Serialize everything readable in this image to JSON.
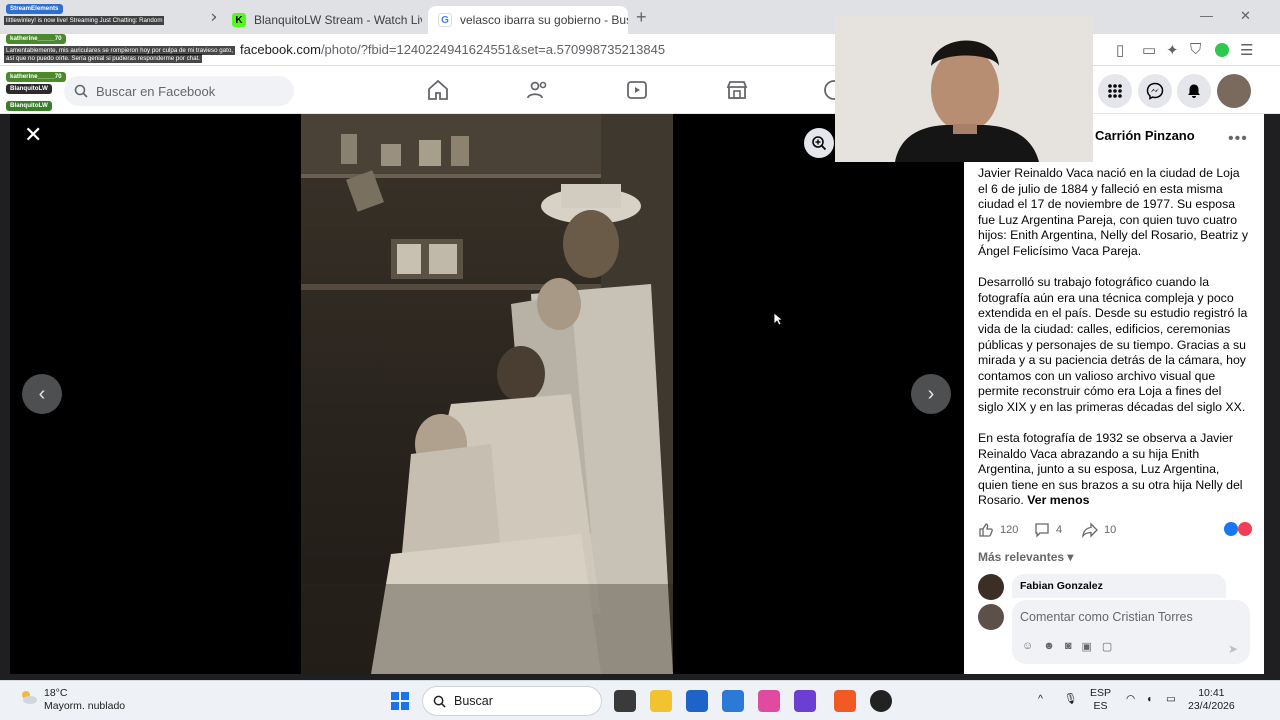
{
  "browser": {
    "tabs": [
      {
        "label": "littlewinley! is now live! Streaming Just Chatting: Random",
        "icon": "stream-icon"
      },
      {
        "label": "BlanquitoLW Stream - Watch Live on",
        "icon": "kick-icon"
      },
      {
        "label": "velasco ibarra su gobierno - Buscar c",
        "icon": "google-icon"
      }
    ],
    "new_tab": "+",
    "url_domain": "facebook.com",
    "url_rest": "/photo/?fbid=1240224941624551&set=a.570998735213845"
  },
  "facebook": {
    "search_placeholder": "Buscar en Facebook",
    "nav_icons": [
      "home-icon",
      "friends-icon",
      "video-icon",
      "marketplace-icon",
      "groups-icon"
    ],
    "header_buttons": [
      "menu-grid-icon",
      "messenger-icon",
      "notifications-icon"
    ]
  },
  "post": {
    "author": "Carrión Pinzano",
    "more": "•••",
    "caption": [
      "Javier Reinaldo Vaca nació en la ciudad de Loja el 6 de julio de 1884 y falleció en esta misma ciudad el 17 de noviembre de 1977. Su esposa fue Luz Argentina Pareja, con quien tuvo cuatro hijos: Enith Argentina, Nelly del Rosario, Beatriz y Ángel Felicísimo Vaca Pareja.",
      "Desarrolló su trabajo fotográfico cuando la fotografía aún era una técnica compleja y poco extendida en el país. Desde su estudio registró la vida de la ciudad: calles, edificios, ceremonias públicas y personajes de su tiempo. Gracias a su mirada y a su paciencia detrás de la cámara, hoy contamos con un valioso archivo visual que permite reconstruir cómo era Loja a fines del siglo XIX y en las primeras décadas del siglo XX.",
      "En esta fotografía de 1932 se observa a Javier Reinaldo Vaca abrazando a su hija Enith Argentina, junto a su esposa, Luz Argentina, quien tiene en sus brazos a su otra hija Nelly del Rosario."
    ],
    "ver_menos": "Ver menos",
    "likes": "120",
    "comments": "4",
    "shares": "10",
    "sort_label": "Más relevantes",
    "first_commenter": "Fabian Gonzalez",
    "comment_placeholder": "Comentar como Cristian Torres"
  },
  "stream_overlay": {
    "widget": "StreamElements",
    "line1": "littlewinley! is now live! Streaming Just Chatting: Random",
    "user1": "katherine_____70",
    "msg1": "Lamentablemente, mis auriculares se rompieron hoy por culpa de mi travieso gato,",
    "msg1b": "así que no puedo oírte. Sería genial si pudieras responderme por chat.",
    "user2": "katherine_____70",
    "user3_partial": "BlanquitoLW",
    "user4": "BlanquitoLW"
  },
  "taskbar": {
    "temperature": "18°C",
    "weather": "Mayorm. nublado",
    "search": "Buscar",
    "lang1": "ESP",
    "lang2": "ES",
    "time": "10:41",
    "date": "23/4/2026"
  },
  "colors": {
    "fb_blue": "#1877f2",
    "viewer_bg": "#000000",
    "panel_bg": "#ffffff"
  }
}
